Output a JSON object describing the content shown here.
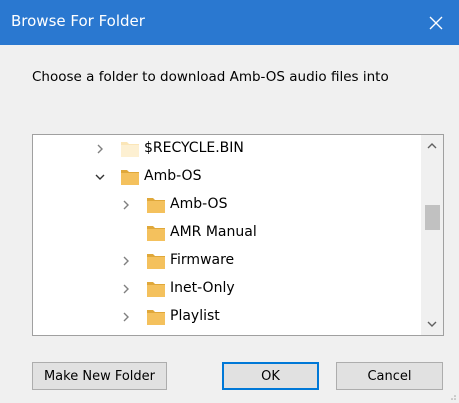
{
  "window": {
    "title": "Browse For Folder"
  },
  "instruction": "Choose a folder to download Amb-OS audio files into",
  "tree": {
    "items": [
      {
        "label": "$RECYCLE.BIN",
        "expander": "collapsed",
        "folder_icon": "folder-icon-faded"
      },
      {
        "label": "Amb-OS",
        "expander": "expanded",
        "folder_icon": "folder-icon"
      },
      {
        "label": "Amb-OS",
        "expander": "collapsed",
        "folder_icon": "folder-icon"
      },
      {
        "label": "AMR Manual",
        "expander": "none",
        "folder_icon": "folder-icon"
      },
      {
        "label": "Firmware",
        "expander": "collapsed",
        "folder_icon": "folder-icon"
      },
      {
        "label": "Inet-Only",
        "expander": "collapsed",
        "folder_icon": "folder-icon"
      },
      {
        "label": "Playlist",
        "expander": "collapsed",
        "folder_icon": "folder-icon"
      }
    ]
  },
  "buttons": {
    "new_folder": "Make New Folder",
    "ok": "OK",
    "cancel": "Cancel"
  },
  "colors": {
    "titlebar": "#2a78d0",
    "folder": "#f4c15d",
    "dialog_bg": "#f0f0f0"
  }
}
